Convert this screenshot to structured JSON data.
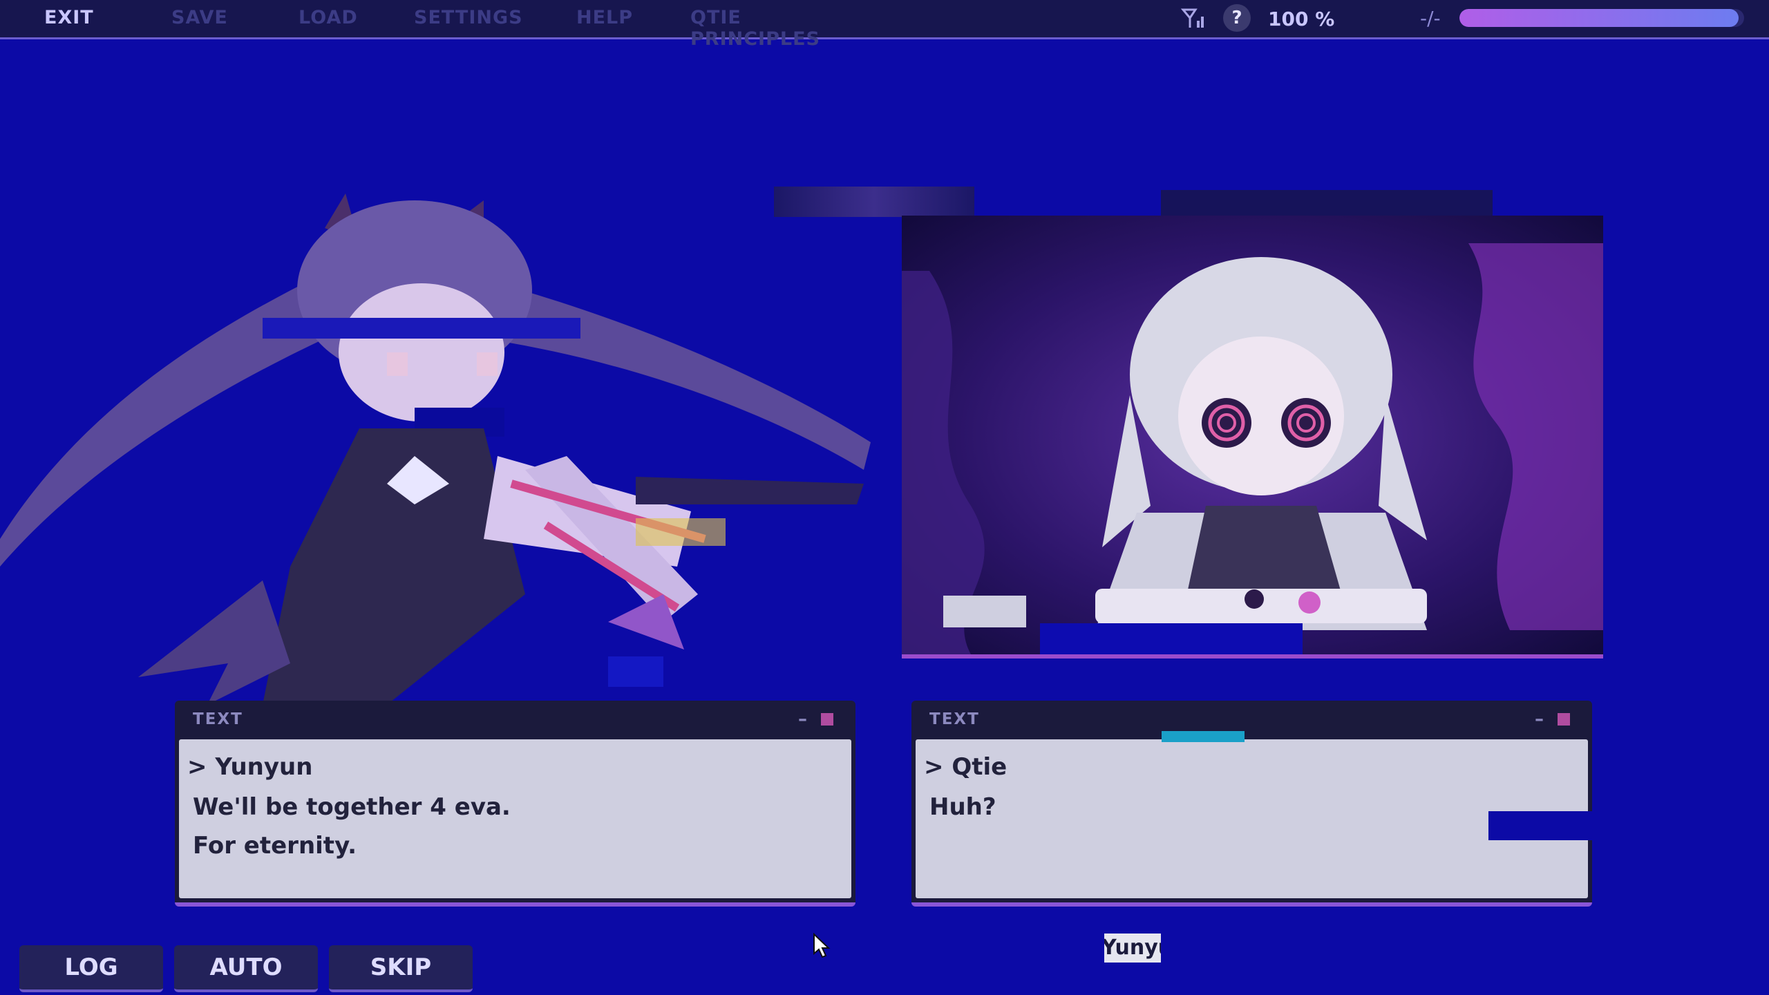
{
  "top_menu": {
    "items": [
      "EXIT",
      "SAVE",
      "LOAD",
      "SETTINGS",
      "HELP",
      "QTIE PRINCIPLES"
    ],
    "help_badge": "?",
    "percent": "100 %",
    "connection_mark": "-/-",
    "progress_fraction": 0.98,
    "icons": [
      "signal-icon",
      "help-icon"
    ]
  },
  "left_box": {
    "title": "TEXT",
    "minimize": "–",
    "speaker": "> Yunyun",
    "lines": [
      "We'll be together 4 eva.",
      "For eternity."
    ]
  },
  "right_box": {
    "title": "TEXT",
    "minimize": "–",
    "speaker": "> Qtie",
    "lines": [
      "Huh?"
    ]
  },
  "buttons": {
    "log": "LOG",
    "auto": "AUTO",
    "skip": "SKIP"
  },
  "name_tag": "Yunyun",
  "colors": {
    "background": "#0c0aa6",
    "topbar": "#17164f",
    "accent": "#8a56d8",
    "box_body": "#cfcfe0"
  }
}
